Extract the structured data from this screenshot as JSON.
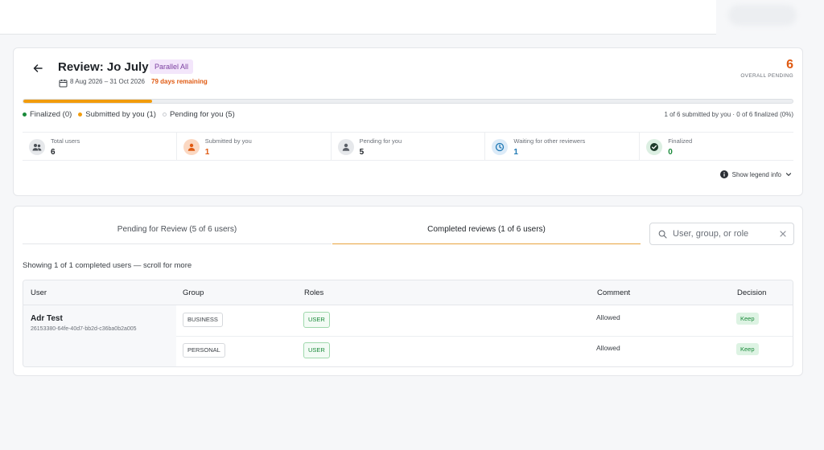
{
  "header": {
    "title": "Review: Jo July 6",
    "badge": "Parallel All",
    "dates": "8 Aug 2026 – 31 Oct 2026",
    "remaining": "79 days remaining",
    "overall_pending_value": "6",
    "overall_pending_label": "OVERALL PENDING"
  },
  "progress": {
    "submitted_fraction": 0.167
  },
  "legend": {
    "finalized": "Finalized (0)",
    "submitted": "Submitted by you (1)",
    "pending": "Pending for you (5)",
    "summary": "1 of 6 submitted by you · 0 of 6 finalized (0%)"
  },
  "stats": [
    {
      "label": "Total users",
      "value": "6",
      "icon": "users-icon"
    },
    {
      "label": "Submitted by you",
      "value": "1",
      "icon": "person-icon"
    },
    {
      "label": "Pending for you",
      "value": "5",
      "icon": "person-icon"
    },
    {
      "label": "Waiting for other reviewers",
      "value": "1",
      "icon": "clock-icon"
    },
    {
      "label": "Finalized",
      "value": "0",
      "icon": "check-circle-icon"
    }
  ],
  "legend_toggle": "Show legend info",
  "tabs": [
    {
      "label": "Pending for Review (5 of 6 users)"
    },
    {
      "label": "Completed reviews (1 of 6 users)"
    }
  ],
  "search": {
    "placeholder": "User, group, or role"
  },
  "showing_text": "Showing 1 of 1 completed users — scroll for more",
  "table": {
    "columns": [
      "User",
      "Group",
      "Roles",
      "Comment",
      "Decision"
    ],
    "user": {
      "name": "Adr Test",
      "id": "26153380-64fe-40d7-bb2d-c36ba0b2a005"
    },
    "rows": [
      {
        "group": "BUSINESS",
        "role": "USER",
        "comment": "Allowed",
        "decision": "Keep"
      },
      {
        "group": "PERSONAL",
        "role": "USER",
        "comment": "Allowed",
        "decision": "Keep"
      }
    ]
  },
  "colors": {
    "accent_orange": "#e05a12",
    "progress": "#f29c0c",
    "finalized_green": "#1a8a3a",
    "submitted_orange": "#f29c0c",
    "waiting_blue": "#1f78b4"
  }
}
